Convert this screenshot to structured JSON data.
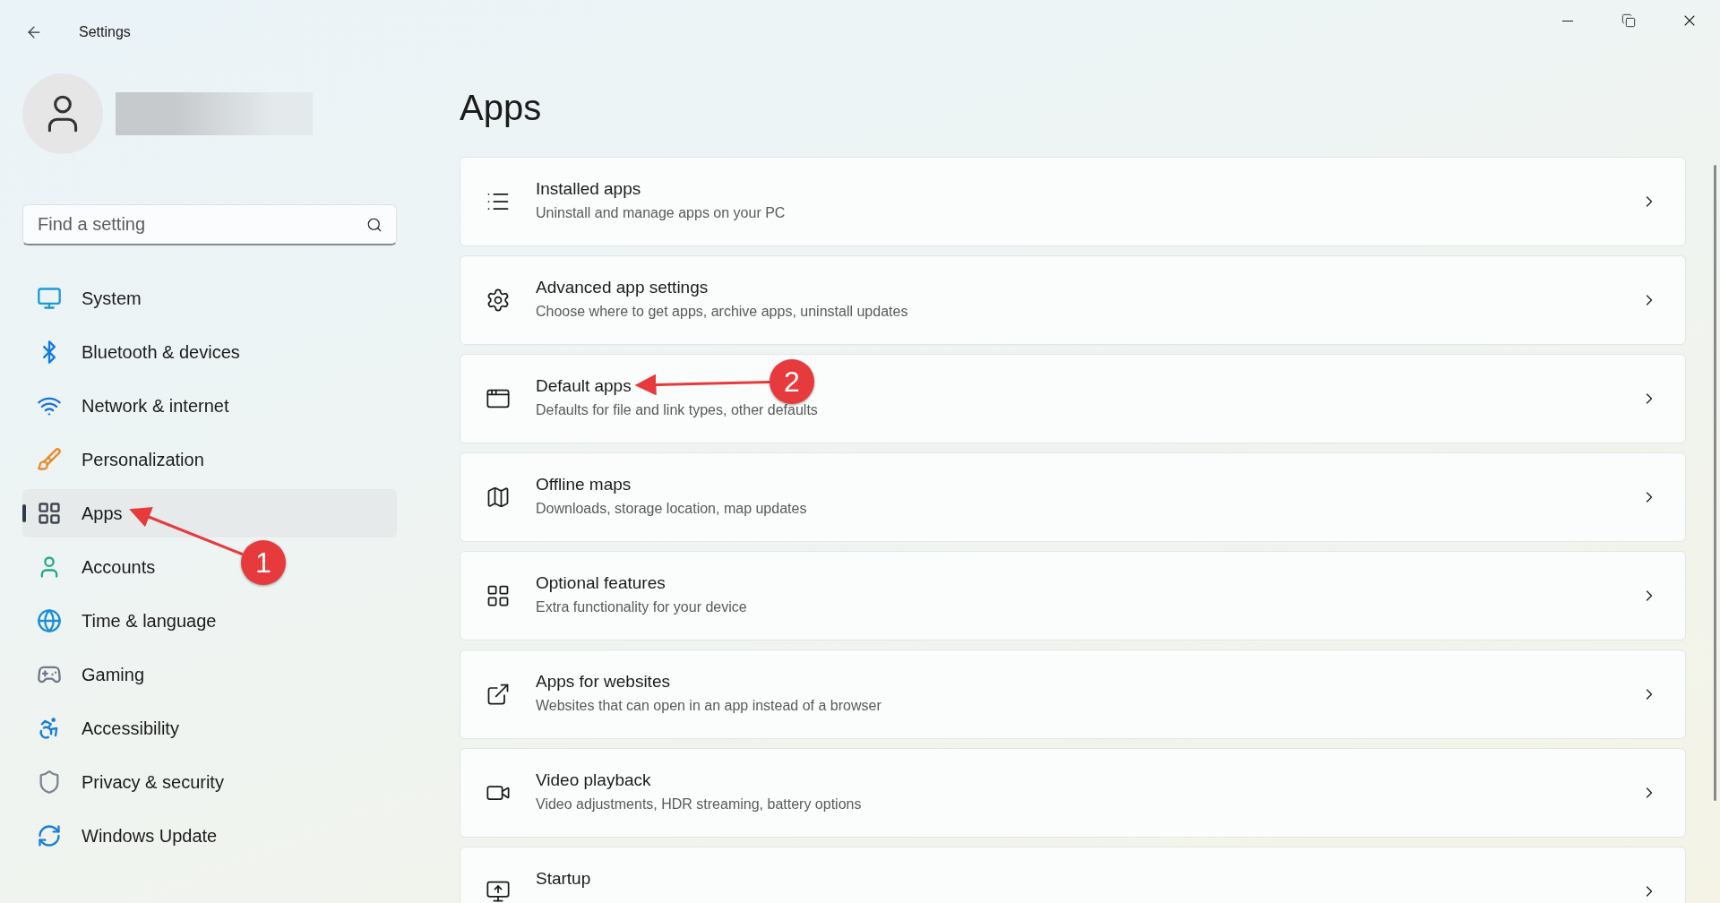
{
  "window": {
    "title": "Settings"
  },
  "search": {
    "placeholder": "Find a setting"
  },
  "sidebar": {
    "items": [
      {
        "label": "System",
        "selected": false
      },
      {
        "label": "Bluetooth & devices",
        "selected": false
      },
      {
        "label": "Network & internet",
        "selected": false
      },
      {
        "label": "Personalization",
        "selected": false
      },
      {
        "label": "Apps",
        "selected": true
      },
      {
        "label": "Accounts",
        "selected": false
      },
      {
        "label": "Time & language",
        "selected": false
      },
      {
        "label": "Gaming",
        "selected": false
      },
      {
        "label": "Accessibility",
        "selected": false
      },
      {
        "label": "Privacy & security",
        "selected": false
      },
      {
        "label": "Windows Update",
        "selected": false
      }
    ]
  },
  "page": {
    "title": "Apps",
    "cards": [
      {
        "title": "Installed apps",
        "description": "Uninstall and manage apps on your PC"
      },
      {
        "title": "Advanced app settings",
        "description": "Choose where to get apps, archive apps, uninstall updates"
      },
      {
        "title": "Default apps",
        "description": "Defaults for file and link types, other defaults"
      },
      {
        "title": "Offline maps",
        "description": "Downloads, storage location, map updates"
      },
      {
        "title": "Optional features",
        "description": "Extra functionality for your device"
      },
      {
        "title": "Apps for websites",
        "description": "Websites that can open in an app instead of a browser"
      },
      {
        "title": "Video playback",
        "description": "Video adjustments, HDR streaming, battery options"
      },
      {
        "title": "Startup"
      }
    ]
  },
  "annotations": [
    {
      "label": "1"
    },
    {
      "label": "2"
    }
  ]
}
